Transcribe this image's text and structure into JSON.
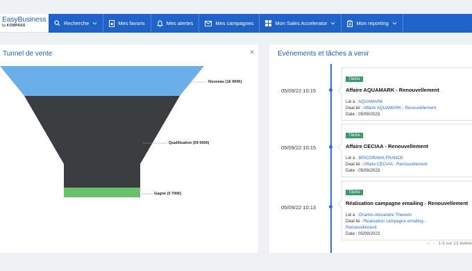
{
  "header": {
    "logo_main": "EasyBusiness",
    "logo_by": "by",
    "logo_brand": "KOMPASS",
    "nav": [
      {
        "label": "Recherche",
        "icon": "search-icon",
        "dropdown": true
      },
      {
        "label": "Mes favoris",
        "icon": "favorites-icon",
        "dropdown": false
      },
      {
        "label": "Mes alertes",
        "icon": "bell-icon",
        "dropdown": false
      },
      {
        "label": "Mes campagnes",
        "icon": "mail-icon",
        "dropdown": false
      },
      {
        "label": "Mon Sales Accelerator",
        "icon": "grid-icon",
        "dropdown": true
      },
      {
        "label": "Mon reporting",
        "icon": "clipboard-icon",
        "dropdown": true
      }
    ]
  },
  "funnel": {
    "title": "Tunnel de vente",
    "close": "×",
    "stages": [
      {
        "label": "Nouveau (16 900€)",
        "color": "#6aaeea"
      },
      {
        "label": "Qualification (59 000€)",
        "color": "#3b3c40"
      },
      {
        "label": "Gagné (5 700€)",
        "color": "#6cbf6c"
      }
    ]
  },
  "events": {
    "title": "Evénements et tâches à venir",
    "items": [
      {
        "date": "05/09/22 10:15",
        "badge": "Tâche",
        "title": "Affaire AQUAMARK - Renouvellement",
        "lie_label": "Lié à :",
        "lie_value": "AQUAMARK",
        "deal_label": "Deal lié :",
        "deal_value": "Affaire AQUAMARK - Renouvellement",
        "date_label": "Date :",
        "date_value": "05/09/2023"
      },
      {
        "date": "05/09/22 10:15",
        "badge": "Tâche",
        "title": "Affaire CECIAA - Renouvellement",
        "lie_label": "Lié à :",
        "lie_value": "BRICORAMA FRANCE",
        "deal_label": "Deal lié :",
        "deal_value": "Affaire CECIAA - Renouvellement",
        "date_label": "Date :",
        "date_value": "05/09/2023"
      },
      {
        "date": "05/09/22 10:13",
        "badge": "Tâche",
        "title": "Réalisation campagne emailing - Renouvellement",
        "lie_label": "Lié à :",
        "lie_value": "Charles-Alexandre Theverin",
        "deal_label": "Deal lié :",
        "deal_value": "Réalisation campagne emailing -",
        "deal_value_2": "Renouvellement",
        "date_label": "Date :",
        "date_value": "05/09/2023"
      }
    ],
    "pager_text": "1-3 sur 13 événe"
  }
}
